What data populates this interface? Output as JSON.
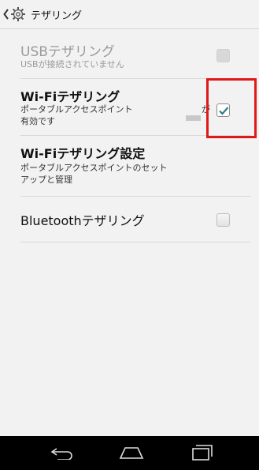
{
  "header": {
    "title": "テザリング",
    "icons": [
      "back-chevron-icon",
      "gear-icon"
    ]
  },
  "settings": {
    "usb": {
      "title": "USBテザリング",
      "subtitle": "USBが接続されていません",
      "checked": false,
      "enabled": false
    },
    "wifi": {
      "title": "Wi-Fiテザリング",
      "subtitle_line1": "ポータブルアクセスポイント",
      "subtitle_suffix": "が",
      "subtitle_line2": "有効です",
      "checked": true,
      "enabled": true
    },
    "wifi_settings": {
      "title": "Wi-Fiテザリング設定",
      "subtitle_line1": "ポータブルアクセスポイントのセット",
      "subtitle_line2": "アップと管理"
    },
    "bluetooth": {
      "title": "Bluetoothテザリング",
      "checked": false,
      "enabled": true
    }
  },
  "navbar": {
    "icons": [
      "back-icon",
      "home-icon",
      "recents-icon"
    ]
  },
  "colors": {
    "background": "#f2f2f2",
    "checkmark": "#2a7f86",
    "highlight": "#e01818",
    "navbar": "#000000"
  }
}
